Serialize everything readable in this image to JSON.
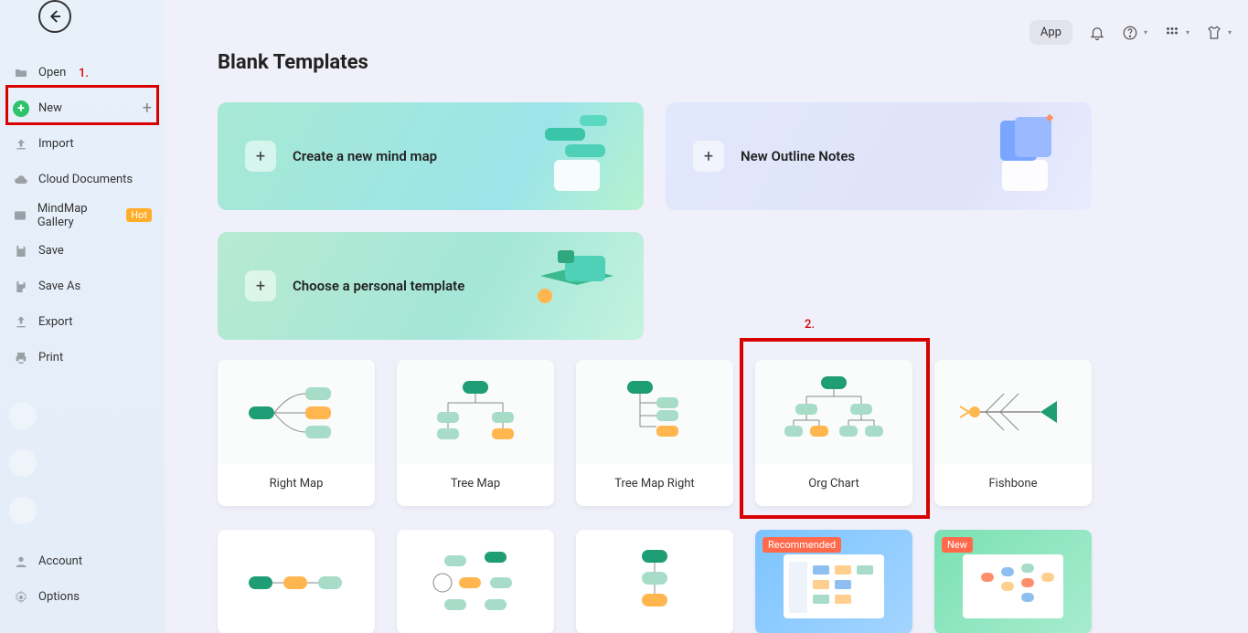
{
  "topbar": {
    "app_label": "App"
  },
  "sidebar": {
    "items": [
      {
        "label": "Open"
      },
      {
        "label": "New"
      },
      {
        "label": "Import"
      },
      {
        "label": "Cloud Documents"
      },
      {
        "label": "MindMap Gallery",
        "badge": "Hot"
      },
      {
        "label": "Save"
      },
      {
        "label": "Save As"
      },
      {
        "label": "Export"
      },
      {
        "label": "Print"
      }
    ],
    "bottom": [
      {
        "label": "Account"
      },
      {
        "label": "Options"
      }
    ]
  },
  "annotations": {
    "one": "1.",
    "two": "2."
  },
  "section_title": "Blank Templates",
  "big_cards": {
    "mind": "Create a new mind map",
    "outline": "New Outline Notes",
    "personal": "Choose a personal template"
  },
  "templates_row1": [
    "Right Map",
    "Tree Map",
    "Tree Map Right",
    "Org Chart",
    "Fishbone"
  ],
  "badges": {
    "recommended": "Recommended",
    "new": "New"
  }
}
